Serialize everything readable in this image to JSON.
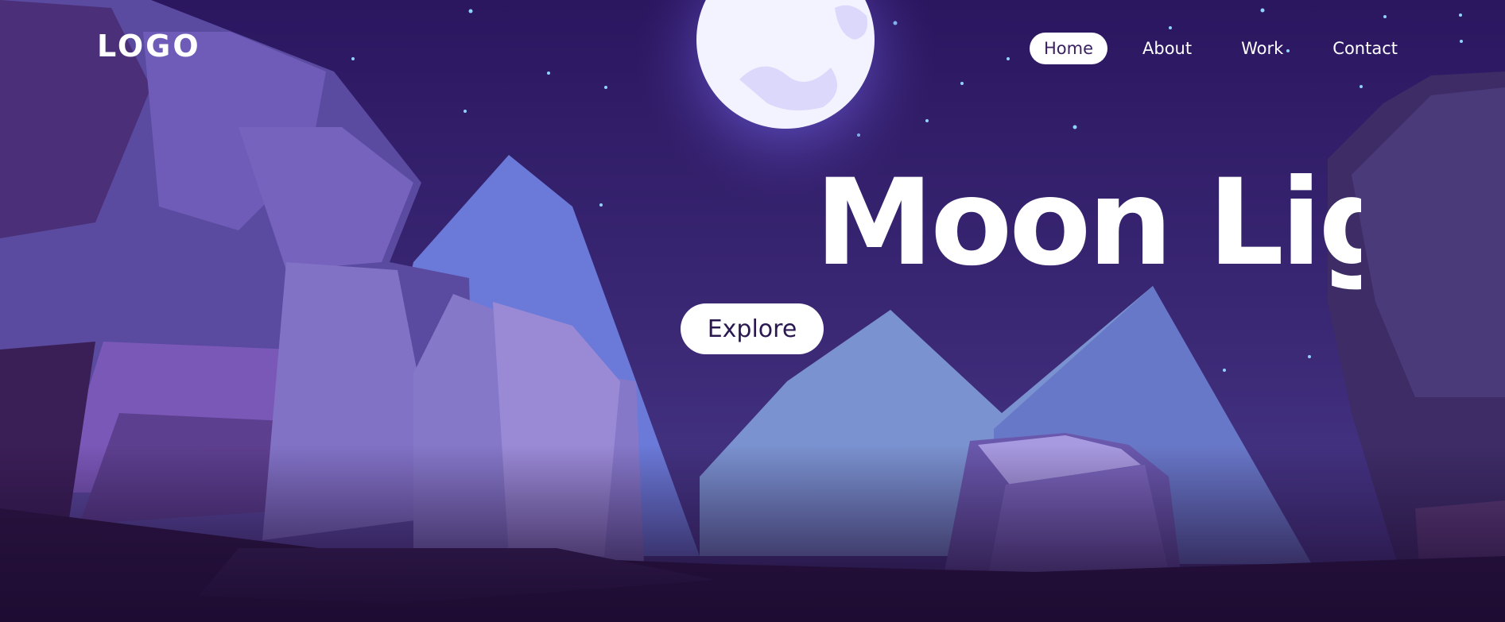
{
  "brand": {
    "logo_text": "LOGO"
  },
  "nav": {
    "items": [
      {
        "label": "Home",
        "active": true
      },
      {
        "label": "About",
        "active": false
      },
      {
        "label": "Work",
        "active": false
      },
      {
        "label": "Contact",
        "active": false
      }
    ]
  },
  "hero": {
    "title": "Moon Light",
    "cta_label": "Explore"
  },
  "colors": {
    "sky_top": "#2d1760",
    "sky_bottom": "#4a3a8a",
    "moon": "#f4f3ff",
    "moon_glow": "#8b7df0",
    "cliff_dark": "#3a2868",
    "cliff_mid": "#6a55b0",
    "cliff_light": "#8c7cd0",
    "mountain_blue": "#6a78d6",
    "mountain_light": "#7d8fd0",
    "ground": "#2a1440"
  }
}
